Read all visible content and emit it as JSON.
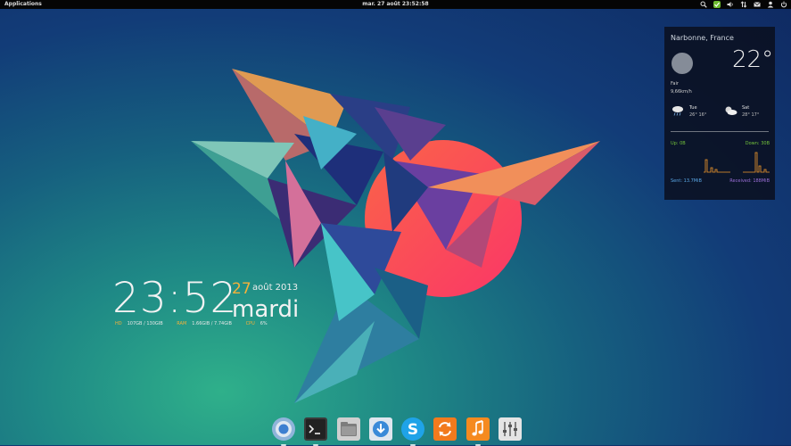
{
  "topbar": {
    "applications": "Applications",
    "clock": "mar. 27 août 23:52:58",
    "indicators": [
      "search-icon",
      "update-icon",
      "volume-icon",
      "network-icon",
      "mail-icon",
      "user-icon",
      "power-icon"
    ]
  },
  "desktop_clock": {
    "time": "23:52",
    "day": "27",
    "month_year": "août 2013",
    "weekday": "mardi",
    "stats": [
      {
        "label": "HD",
        "value": "107GB / 130GIB"
      },
      {
        "label": "RAM",
        "value": "1.66GIB / 7.74GIB"
      },
      {
        "label": "CPU",
        "value": "6%"
      }
    ],
    "accent_color": "#f5b13a"
  },
  "weather": {
    "city": "Narbonne, France",
    "temperature": "22°",
    "condition": "Fair",
    "wind": "9,66km/h",
    "forecast": [
      {
        "day": "Tue",
        "temps": "26° 16°",
        "icon": "rain-cloud-icon"
      },
      {
        "day": "Sat",
        "temps": "28° 17°",
        "icon": "partly-cloudy-icon"
      }
    ]
  },
  "network": {
    "up": "Up: 0B",
    "down": "Down: 30B",
    "sent": "Sent: 13.7MiB",
    "received": "Received: 188MiB",
    "up_color": "#73c23b",
    "sent_color": "#5aa7e6",
    "received_color": "#9b6fd8"
  },
  "dock": {
    "items": [
      {
        "name": "chromium",
        "icon": "chromium-icon",
        "running": true
      },
      {
        "name": "terminal",
        "icon": "terminal-icon",
        "running": true
      },
      {
        "name": "files",
        "icon": "files-icon",
        "running": false
      },
      {
        "name": "downloads",
        "icon": "download-icon",
        "running": false
      },
      {
        "name": "skype",
        "icon": "skype-icon",
        "running": true
      },
      {
        "name": "software-updater",
        "icon": "sync-icon",
        "running": false
      },
      {
        "name": "music",
        "icon": "music-icon",
        "running": true
      },
      {
        "name": "settings",
        "icon": "equalizer-icon",
        "running": false
      }
    ]
  }
}
